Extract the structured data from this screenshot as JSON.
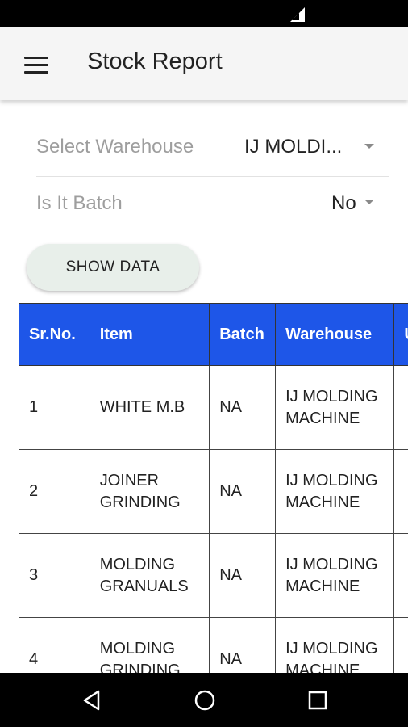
{
  "app_bar": {
    "title": "Stock Report"
  },
  "filters": {
    "warehouse": {
      "label": "Select Warehouse",
      "value": "IJ MOLDI..."
    },
    "batch": {
      "label": "Is It Batch",
      "value": "No"
    }
  },
  "show_button": {
    "label": "SHOW DATA"
  },
  "table": {
    "headers": [
      "Sr.No.",
      "Item",
      "Batch",
      "Warehouse",
      "U"
    ],
    "rows": [
      [
        "1",
        "WHITE M.B",
        "NA",
        "IJ MOLDING MACHINE",
        ""
      ],
      [
        "2",
        "JOINER GRINDING",
        "NA",
        "IJ MOLDING MACHINE",
        ""
      ],
      [
        "3",
        "MOLDING GRANUALS",
        "NA",
        "IJ MOLDING MACHINE",
        ""
      ],
      [
        "4",
        "MOLDING GRINDING",
        "NA",
        "IJ MOLDING MACHINE",
        ""
      ]
    ]
  },
  "colors": {
    "table_header": "#1e56e8",
    "status_bar": "#000000",
    "app_bar": "#f5f5f5"
  },
  "icons": {
    "status": "signal-icon",
    "menu": "menu-icon",
    "nav": [
      "back-icon",
      "home-icon",
      "recents-icon"
    ]
  }
}
